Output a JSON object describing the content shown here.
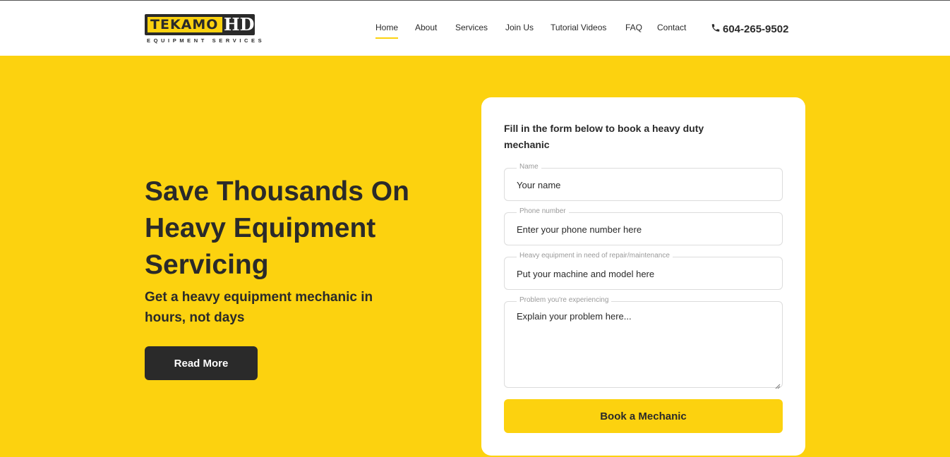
{
  "brand": {
    "logo_main": "TEKAMO",
    "logo_hd": "HD",
    "logo_sub": "EQUIPMENT SERVICES",
    "accent_color": "#fcd20f",
    "dark_color": "#2a2a2a"
  },
  "nav": {
    "items": [
      {
        "label": "Home",
        "active": true
      },
      {
        "label": "About"
      },
      {
        "label": "Services"
      },
      {
        "label": "Join Us"
      },
      {
        "label": "Tutorial Videos"
      },
      {
        "label": "FAQ"
      },
      {
        "label": "Contact"
      }
    ],
    "phone": "604-265-9502",
    "phone_icon": "phone-icon"
  },
  "hero": {
    "title": "Save Thousands On Heavy Equipment Servicing",
    "subtitle": "Get a heavy equipment mechanic in hours, not days",
    "cta": "Read More"
  },
  "form": {
    "title": "Fill in the form below to book a heavy duty mechanic",
    "fields": [
      {
        "label": "Name",
        "placeholder": "Your name"
      },
      {
        "label": "Phone number",
        "placeholder": "Enter your phone number here"
      },
      {
        "label": "Heavy equipment in need of repair/maintenance",
        "placeholder": "Put your machine and model here"
      },
      {
        "label": "Problem you're experiencing",
        "placeholder": "Explain your problem here..."
      }
    ],
    "submit": "Book a Mechanic"
  }
}
